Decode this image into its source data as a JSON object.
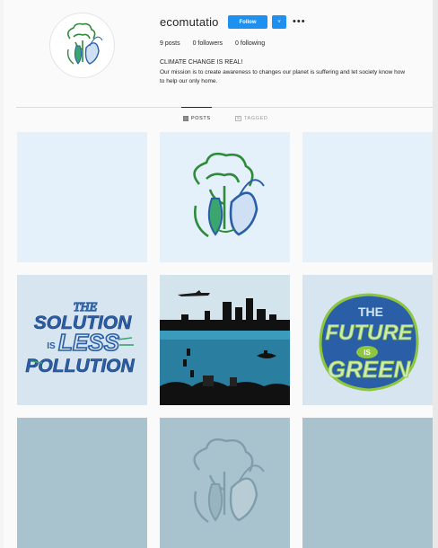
{
  "profile": {
    "username": "ecomutatio",
    "follow_label": "Follow",
    "dropdown_glyph": "˅",
    "more_glyph": "•••",
    "stats": {
      "posts": "9 posts",
      "followers": "0 followers",
      "following": "0 following"
    },
    "bio_title": "CLIMATE CHANGE IS REAL!",
    "bio_text": "Our mission is to create awareness to changes our planet is suffering and let society know how to help our only home."
  },
  "tabs": {
    "posts": "POSTS",
    "tagged": "TAGGED"
  },
  "posts": {
    "p4": {
      "line1": "THE",
      "line2": "SOLUTION",
      "line3": "IS",
      "line4": "LESS",
      "line5": "POLLUTION"
    },
    "p6": {
      "line1": "THE",
      "line2": "FUTURE",
      "line3": "IS",
      "line4": "GREEN"
    }
  },
  "colors": {
    "follow": "#1e90f0",
    "brand_green": "#2e8b3a",
    "brand_blue": "#2a5fa8"
  }
}
